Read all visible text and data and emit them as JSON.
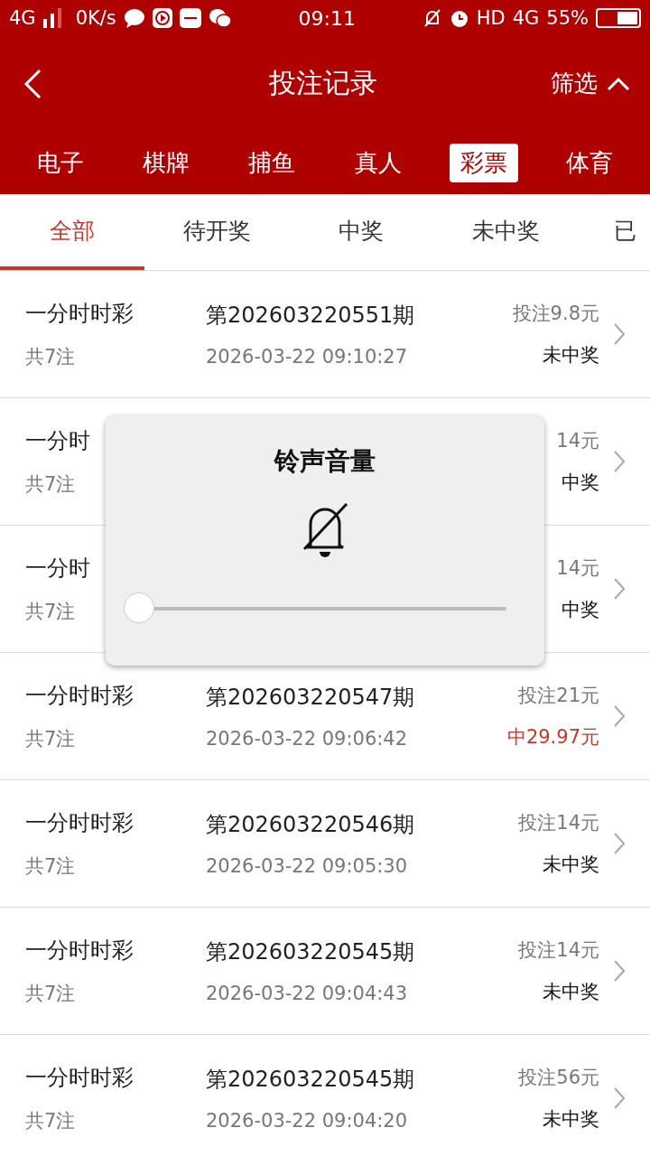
{
  "status_bar": {
    "network": "4G",
    "speed": "0K/s",
    "time": "09:11",
    "hd": "HD",
    "network_right": "4G",
    "battery": "55%"
  },
  "header": {
    "title": "投注记录",
    "filter": "筛选"
  },
  "categories": [
    {
      "label": "电子",
      "selected": false
    },
    {
      "label": "棋牌",
      "selected": false
    },
    {
      "label": "捕鱼",
      "selected": false
    },
    {
      "label": "真人",
      "selected": false
    },
    {
      "label": "彩票",
      "selected": true
    },
    {
      "label": "体育",
      "selected": false
    }
  ],
  "tabs": [
    {
      "label": "全部",
      "selected": true
    },
    {
      "label": "待开奖",
      "selected": false
    },
    {
      "label": "中奖",
      "selected": false
    },
    {
      "label": "未中奖",
      "selected": false
    },
    {
      "label": "已",
      "selected": false
    }
  ],
  "records": [
    {
      "game": "一分时时彩",
      "count": "共7注",
      "issue": "第202603220551期",
      "time": "2026-03-22 09:10:27",
      "stake": "投注9.8元",
      "result": "未中奖",
      "won": false
    },
    {
      "game": "一分时",
      "count": "共7注",
      "stake": "14元",
      "result": "中奖",
      "won": false
    },
    {
      "game": "一分时",
      "count": "共7注",
      "stake": "14元",
      "result": "中奖",
      "won": false
    },
    {
      "game": "一分时时彩",
      "count": "共7注",
      "issue": "第202603220547期",
      "time": "2026-03-22 09:06:42",
      "stake": "投注21元",
      "result": "中29.97元",
      "won": true
    },
    {
      "game": "一分时时彩",
      "count": "共7注",
      "issue": "第202603220546期",
      "time": "2026-03-22 09:05:30",
      "stake": "投注14元",
      "result": "未中奖",
      "won": false
    },
    {
      "game": "一分时时彩",
      "count": "共7注",
      "issue": "第202603220545期",
      "time": "2026-03-22 09:04:43",
      "stake": "投注14元",
      "result": "未中奖",
      "won": false
    },
    {
      "game": "一分时时彩",
      "count": "共7注",
      "issue": "第202603220545期",
      "time": "2026-03-22 09:04:20",
      "stake": "投注56元",
      "result": "未中奖",
      "won": false
    }
  ],
  "volume_dialog": {
    "title": "铃声音量",
    "level": 0
  }
}
